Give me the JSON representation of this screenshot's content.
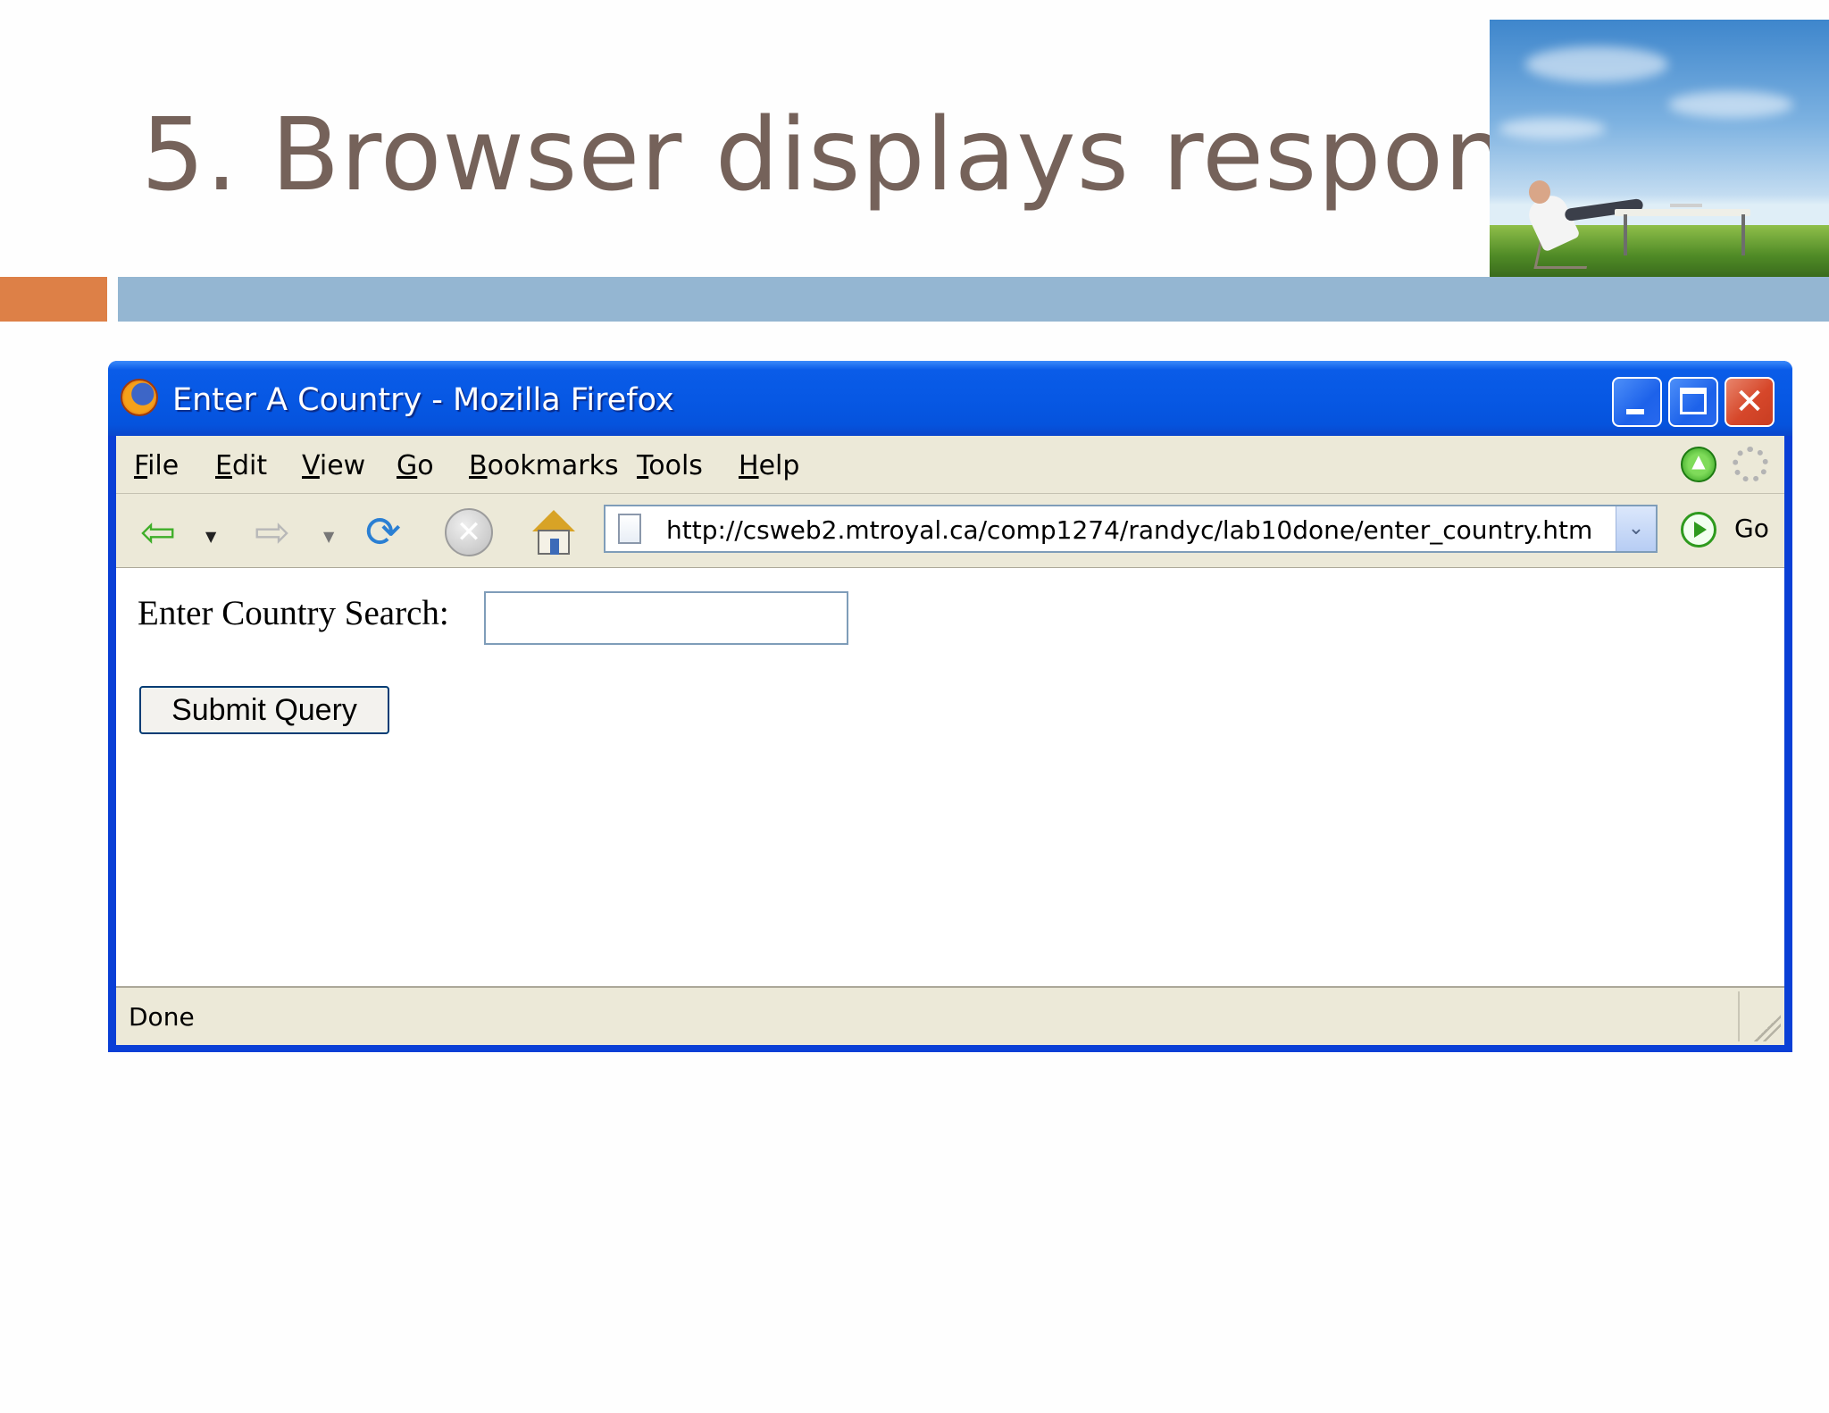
{
  "slide": {
    "title": "5. Browser displays response",
    "colors": {
      "title": "#75625a",
      "accent_orange": "#dd8047",
      "accent_blue": "#94b6d2"
    }
  },
  "window": {
    "title": "Enter A Country - Mozilla Firefox",
    "controls": [
      "minimize-icon",
      "maximize-icon",
      "close-icon"
    ]
  },
  "menubar": {
    "items": [
      {
        "label": "File",
        "accel": "F",
        "rest": "ile"
      },
      {
        "label": "Edit",
        "accel": "E",
        "rest": "dit"
      },
      {
        "label": "View",
        "accel": "V",
        "rest": "iew"
      },
      {
        "label": "Go",
        "accel": "G",
        "rest": "o"
      },
      {
        "label": "Bookmarks",
        "accel": "B",
        "rest": "ookmarks"
      },
      {
        "label": "Tools",
        "accel": "T",
        "rest": "ools"
      },
      {
        "label": "Help",
        "accel": "H",
        "rest": "elp"
      }
    ]
  },
  "navbar": {
    "buttons": [
      "back-icon",
      "forward-icon",
      "reload-icon",
      "stop-icon",
      "home-icon"
    ],
    "url": "http://csweb2.mtroyal.ca/comp1274/randyc/lab10done/enter_country.htm",
    "go_label": "Go"
  },
  "page": {
    "search_label": "Enter Country Search:",
    "search_value": "",
    "submit_label": "Submit Query"
  },
  "status": {
    "text": "Done"
  }
}
